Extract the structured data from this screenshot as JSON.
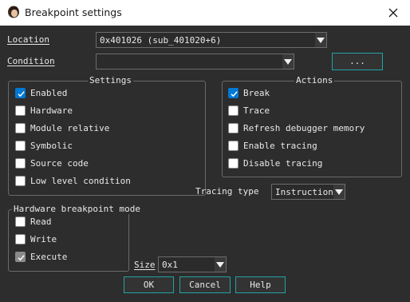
{
  "window": {
    "title": "Breakpoint settings",
    "close_glyph": "✕"
  },
  "location": {
    "label": "Location",
    "value": "0x401026 (sub_401020+6)"
  },
  "condition": {
    "label": "Condition",
    "value": "",
    "browse_label": "..."
  },
  "settings": {
    "title": "Settings",
    "items": [
      {
        "label": "Enabled",
        "checked": true
      },
      {
        "label": "Hardware",
        "checked": false
      },
      {
        "label": "Module relative",
        "checked": false
      },
      {
        "label": "Symbolic",
        "checked": false
      },
      {
        "label": "Source code",
        "checked": false
      },
      {
        "label": "Low level condition",
        "checked": false
      }
    ]
  },
  "actions": {
    "title": "Actions",
    "items": [
      {
        "label": "Break",
        "checked": true
      },
      {
        "label": "Trace",
        "checked": false
      },
      {
        "label": "Refresh debugger memory",
        "checked": false
      },
      {
        "label": "Enable tracing",
        "checked": false
      },
      {
        "label": "Disable tracing",
        "checked": false
      }
    ]
  },
  "tracing": {
    "label": "Tracing type",
    "value": "Instructions"
  },
  "hw_mode": {
    "title": "Hardware breakpoint mode",
    "items": [
      {
        "label": "Read",
        "checked": false
      },
      {
        "label": "Write",
        "checked": false
      },
      {
        "label": "Execute",
        "checked": true,
        "disabled": true
      }
    ]
  },
  "size": {
    "label": "Size",
    "value": "0x1"
  },
  "buttons": {
    "ok": "OK",
    "cancel": "Cancel",
    "help": "Help"
  },
  "colors": {
    "accent": "#0078d4",
    "button_border": "#21a3a6",
    "background": "#2d2d2d"
  }
}
